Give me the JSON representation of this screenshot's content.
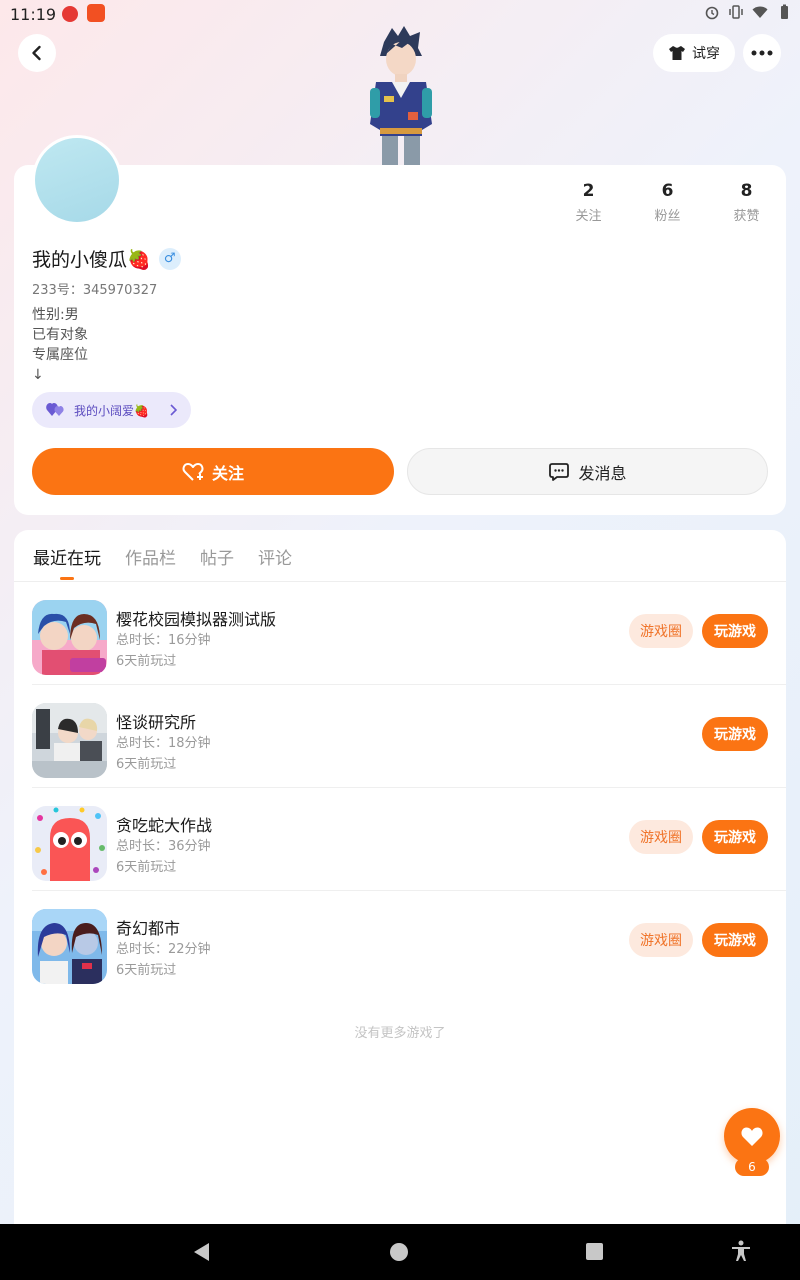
{
  "status_bar": {
    "time": "11:19",
    "icons": [
      "alarm-icon",
      "vibrate-icon",
      "wifi-icon",
      "battery-icon"
    ]
  },
  "header": {
    "tryon_label": "试穿"
  },
  "profile": {
    "stats": [
      {
        "value": "2",
        "label": "关注"
      },
      {
        "value": "6",
        "label": "粉丝"
      },
      {
        "value": "8",
        "label": "获赞"
      }
    ],
    "username": "我的小傻瓜🍓",
    "gender_symbol": "♂",
    "uid": "233号：345970327",
    "bio_lines": [
      "性别:男",
      "已有对象",
      "专属座位",
      "↓"
    ],
    "cp_tag": "我的小阔爱🍓",
    "follow_label": "关注",
    "message_label": "发消息"
  },
  "tabs": [
    {
      "label": "最近在玩",
      "active": true
    },
    {
      "label": "作品栏",
      "active": false
    },
    {
      "label": "帖子",
      "active": false
    },
    {
      "label": "评论",
      "active": false
    }
  ],
  "games": [
    {
      "title": "樱花校园模拟器测试版",
      "duration": "总时长：16分钟",
      "last_played": "6天前玩过",
      "has_circle": true
    },
    {
      "title": "怪谈研究所",
      "duration": "总时长：18分钟",
      "last_played": "6天前玩过",
      "has_circle": false
    },
    {
      "title": "贪吃蛇大作战",
      "duration": "总时长：36分钟",
      "last_played": "6天前玩过",
      "has_circle": true
    },
    {
      "title": "奇幻都市",
      "duration": "总时长：22分钟",
      "last_played": "6天前玩过",
      "has_circle": true
    }
  ],
  "game_buttons": {
    "circle_label": "游戏圈",
    "play_label": "玩游戏"
  },
  "no_more_text": "没有更多游戏了",
  "fab": {
    "count": "6"
  },
  "colors": {
    "accent": "#fb7413",
    "accent_light": "#fde9de",
    "cp_bg": "#ebe9fb",
    "cp_text": "#5b4bbf"
  }
}
